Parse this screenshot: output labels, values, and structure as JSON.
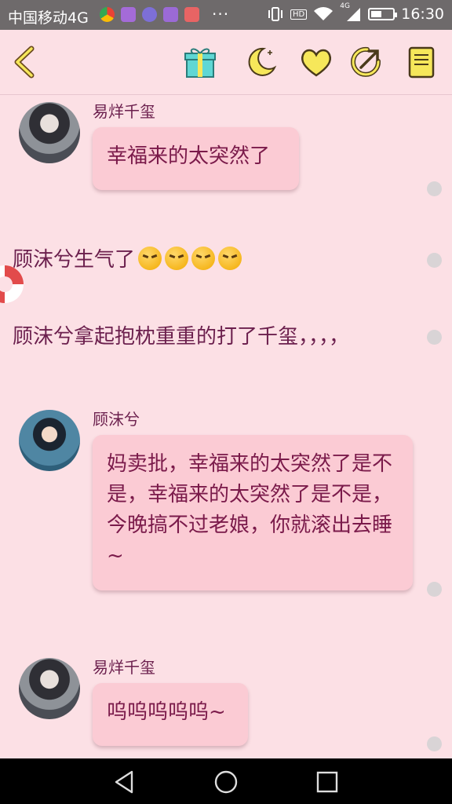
{
  "statusbar": {
    "carrier": "中国移动4G",
    "dots": "···",
    "network": "4G",
    "time": "16:30",
    "battery_level": 0.5,
    "hd": "HD"
  },
  "toolbar": {
    "icons": [
      "back-chevron-icon",
      "gift-icon",
      "moon-icon",
      "heart-icon",
      "share-icon",
      "book-icon"
    ],
    "accent": "#f6e75a"
  },
  "messages": [
    {
      "type": "chat",
      "sender": "易烊千玺",
      "text": "幸福来的太突然了"
    },
    {
      "type": "narration",
      "text": "顾沫兮生气了"
    },
    {
      "type": "narration",
      "text": "顾沫兮拿起抱枕重重的打了千玺，，，，"
    },
    {
      "type": "chat",
      "sender": "顾沫兮",
      "text": "妈卖批，幸福来的太突然了是不是，幸福来的太突然了是不是，今晚搞不过老娘，你就滚出去睡~"
    },
    {
      "type": "chat",
      "sender": "易烊千玺",
      "text": "呜呜呜呜呜~"
    }
  ],
  "colors": {
    "background": "#fce0e5",
    "bubble": "#fbcbd4",
    "text": "#6b1f4d"
  }
}
